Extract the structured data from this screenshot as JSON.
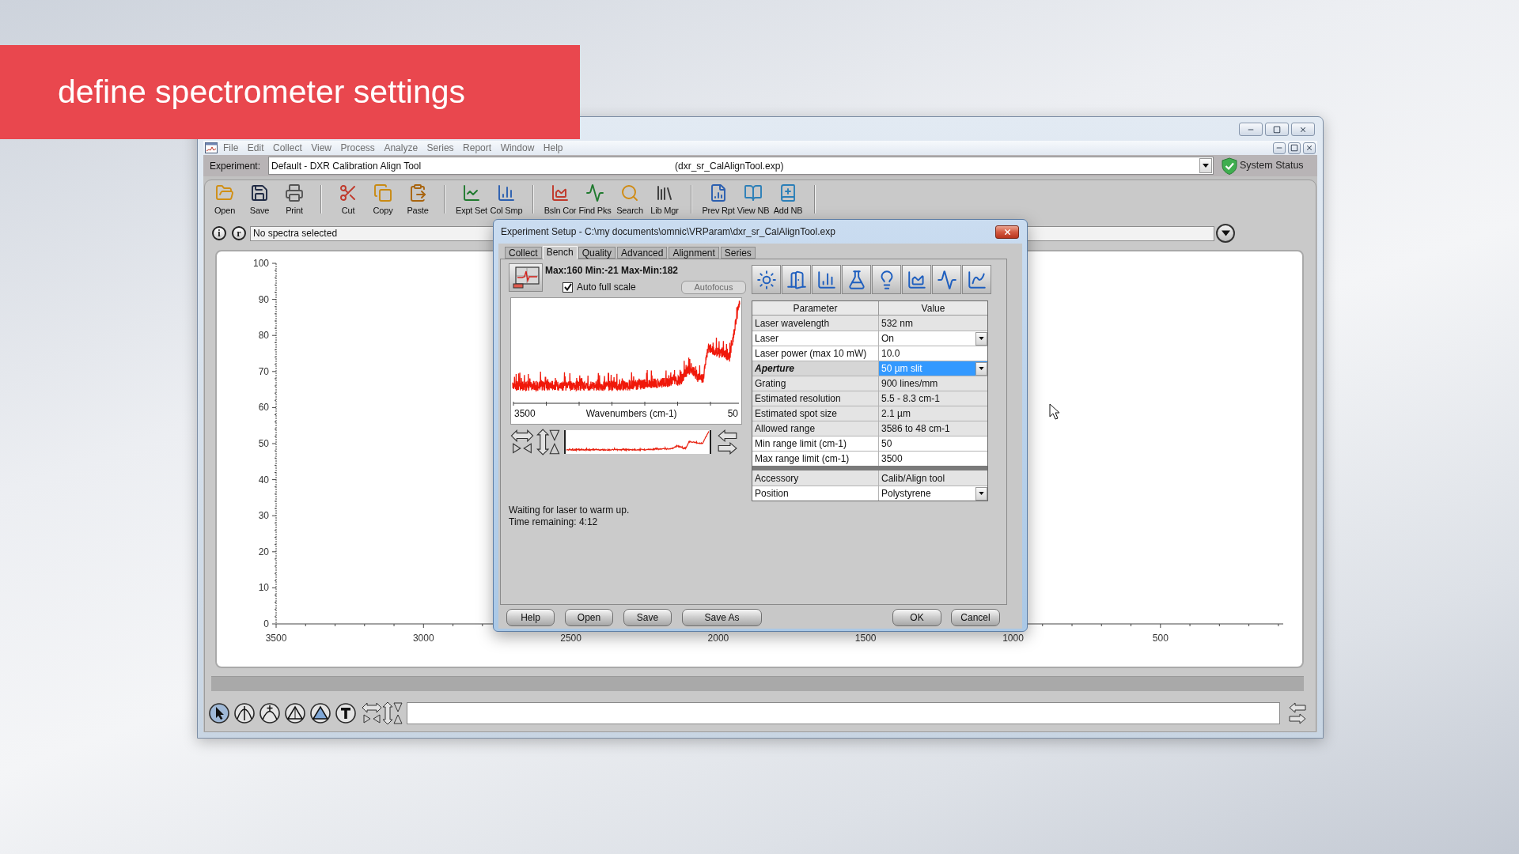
{
  "banner": {
    "title": "define spectrometer settings"
  },
  "app": {
    "menu": [
      "File",
      "Edit",
      "Collect",
      "View",
      "Process",
      "Analyze",
      "Series",
      "Report",
      "Window",
      "Help"
    ],
    "experiment": {
      "label": "Experiment:",
      "value": "Default - DXR Calibration Align Tool",
      "file": "(dxr_sr_CalAlignTool.exp)"
    },
    "system_status": "System Status",
    "toolbar_groups": [
      {
        "buttons": [
          "Open",
          "Save",
          "Print"
        ]
      },
      {
        "buttons": [
          "Cut",
          "Copy",
          "Paste"
        ]
      },
      {
        "buttons": [
          "Expt Set",
          "Col Smp"
        ]
      },
      {
        "buttons": [
          "Bsln Cor",
          "Find Pks",
          "Search",
          "Lib Mgr"
        ]
      },
      {
        "buttons": [
          "Prev Rpt",
          "View NB",
          "Add NB"
        ]
      }
    ],
    "info_buttons": [
      "i",
      "r"
    ],
    "spectra_field": "No spectra selected",
    "plot": {
      "y_ticks": [
        "100",
        "90",
        "80",
        "70",
        "60",
        "50",
        "40",
        "30",
        "20",
        "10",
        "0"
      ],
      "x_ticks": [
        "3500",
        "3000",
        "2500",
        "2000",
        "1500",
        "1000",
        "500"
      ]
    }
  },
  "dialog": {
    "title": "Experiment Setup - C:\\my documents\\omnic\\VRParam\\dxr_sr_CalAlignTool.exp",
    "tabs": [
      {
        "label": "Collect",
        "selected": false
      },
      {
        "label": "Bench",
        "selected": true
      },
      {
        "label": "Quality",
        "selected": false
      },
      {
        "label": "Advanced",
        "selected": false
      },
      {
        "label": "Alignment",
        "selected": false
      },
      {
        "label": "Series",
        "selected": false
      }
    ],
    "scale_readout": "Max:160 Min:-21 Max-Min:182",
    "auto_full_scale": {
      "label": "Auto full scale",
      "checked": true
    },
    "autofocus": {
      "label": "Autofocus",
      "disabled": true
    },
    "preview": {
      "x_start": "3500",
      "x_label": "Wavenumbers (cm-1)",
      "x_end": "50"
    },
    "status_lines": [
      "Waiting for laser to warm up.",
      "Time remaining: 4:12"
    ],
    "table": {
      "columns": [
        "Parameter",
        "Value"
      ],
      "groups": [
        {
          "rows": [
            {
              "parameter": "Laser wavelength",
              "value": "532 nm",
              "kind": "text",
              "editable": false,
              "selected": false
            },
            {
              "parameter": "Laser",
              "value": "On",
              "kind": "dropdown",
              "editable": true,
              "selected": false
            },
            {
              "parameter": "Laser power (max 10 mW)",
              "value": "10.0",
              "kind": "text",
              "editable": true,
              "selected": false
            },
            {
              "parameter": "Aperture",
              "value": "50 µm slit",
              "kind": "dropdown",
              "editable": true,
              "selected": true
            },
            {
              "parameter": "Grating",
              "value": "900 lines/mm",
              "kind": "text",
              "editable": false,
              "selected": false
            },
            {
              "parameter": "Estimated resolution",
              "value": "5.5 - 8.3 cm-1",
              "kind": "text",
              "editable": false,
              "selected": false
            },
            {
              "parameter": "Estimated spot size",
              "value": "2.1 µm",
              "kind": "text",
              "editable": false,
              "selected": false
            },
            {
              "parameter": "Allowed range",
              "value": "3586 to 48 cm-1",
              "kind": "text",
              "editable": false,
              "selected": false
            },
            {
              "parameter": "Min range limit (cm-1)",
              "value": "50",
              "kind": "text",
              "editable": true,
              "selected": false
            },
            {
              "parameter": "Max range limit (cm-1)",
              "value": "3500",
              "kind": "text",
              "editable": true,
              "selected": false
            }
          ]
        },
        {
          "rows": [
            {
              "parameter": "Accessory",
              "value": "Calib/Align tool",
              "kind": "text",
              "editable": false,
              "selected": false
            },
            {
              "parameter": "Position",
              "value": "Polystyrene",
              "kind": "dropdown",
              "editable": true,
              "selected": false
            }
          ]
        }
      ]
    },
    "buttons_left": [
      "Help",
      "Open",
      "Save",
      "Save As"
    ],
    "buttons_right": [
      "OK",
      "Cancel"
    ]
  }
}
